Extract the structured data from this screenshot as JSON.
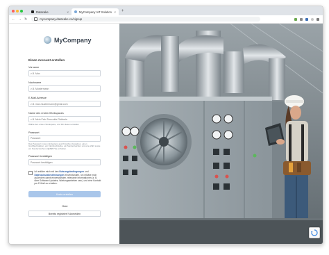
{
  "browser": {
    "tabs": [
      {
        "title": "Datacake",
        "active": false
      },
      {
        "title": "MyCompany IoT Solution",
        "active": true
      }
    ],
    "url": "mycompany.datacake.co/signup"
  },
  "brand": {
    "name": "MyCompany"
  },
  "form": {
    "title": "Einen Account erstellen",
    "fields": [
      {
        "label": "Vorname",
        "placeholder": "z.B. Max"
      },
      {
        "label": "Nachname",
        "placeholder": "z.B. Mustermann"
      },
      {
        "label": "E-Mail-Adresse",
        "placeholder": "z.B. max.mustermann@gmail.com"
      },
      {
        "label": "Name des ersten Workspaces",
        "placeholder": "z.B. Mein Palo Tomcolde Richterle",
        "hint": "Wähle den ersten Workspace, und füh diesen erstellen"
      },
      {
        "label": "Passwort",
        "placeholder": "Passwort",
        "hint": "Das Passwort muss mindestens aus 8 Zeichen bestehen, einen Großbuchstaben, ein Kleinbuchstabe, ein Sonderzeichen und eine Zahl sowie ein Sonderzeichen (!@#$%^&) enthalten."
      },
      {
        "label": "Passwort bestätigen",
        "placeholder": "Passwort bestätigen"
      }
    ],
    "consent": {
      "prefix": "Ich erkläre mich mit den",
      "terms": "Nutzungsbedingungen",
      "middle": "und",
      "privacy": "Datenschutzbestimmungen",
      "suffix": "einverstanden. Ich erkläre mich außerdem damit einverstanden, relevante Informationen (z. B. über Software-Updates, Wartungsarbeiten usw.) und eine Kontakt per E-Mail zu erhalten."
    },
    "submit_label": "Konto erstellen",
    "or_label": "Oder",
    "login_label": "Bereits registriert? Anmelden"
  },
  "colors": {
    "primary_button": "#a9c6ea",
    "link": "#2f5fa6"
  }
}
